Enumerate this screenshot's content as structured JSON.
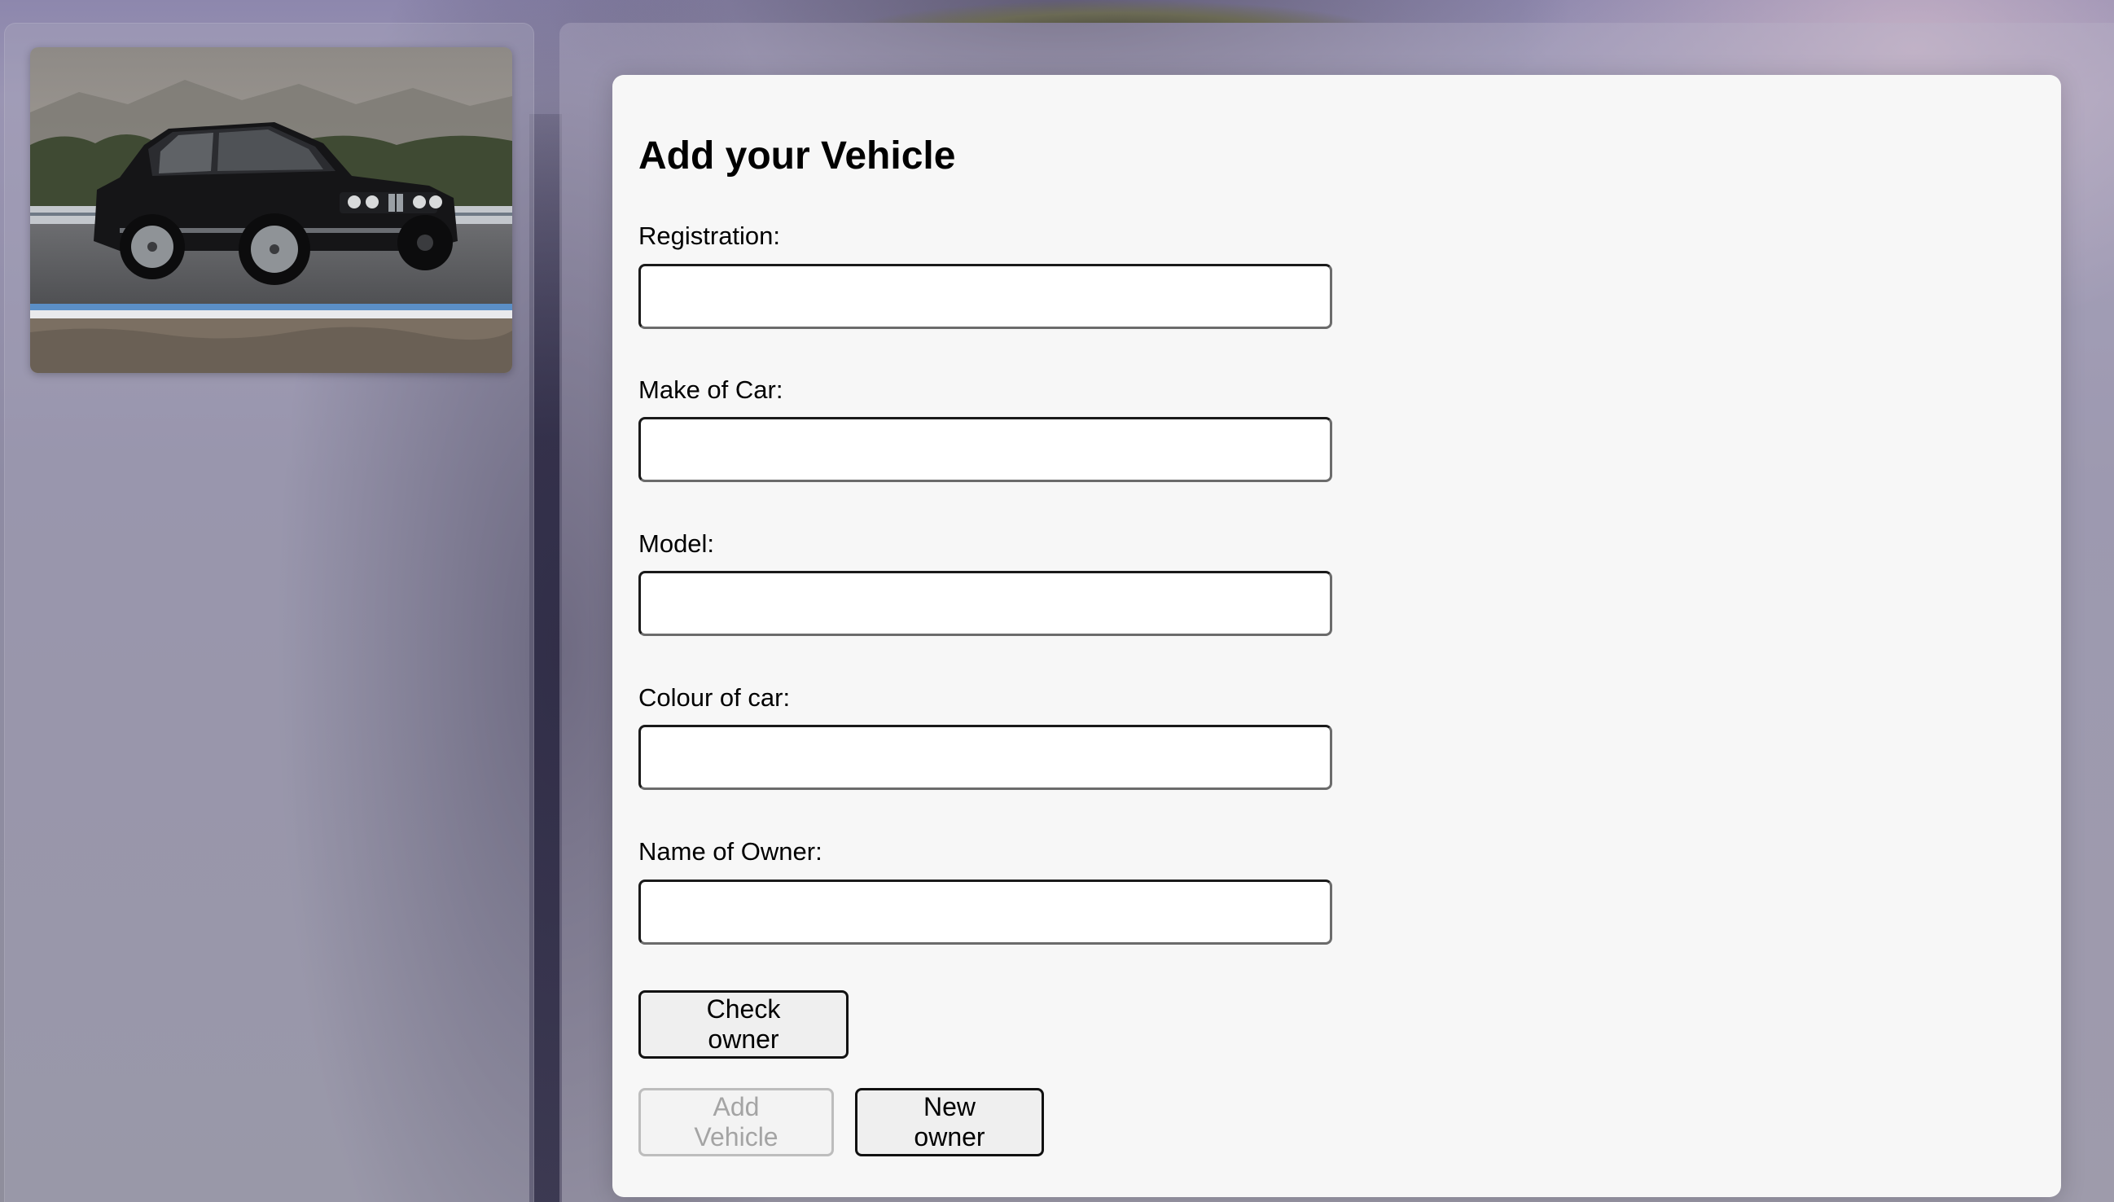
{
  "form": {
    "title": "Add your Vehicle",
    "fields": [
      {
        "label": "Registration:",
        "value": "",
        "placeholder": ""
      },
      {
        "label": "Make of Car:",
        "value": "",
        "placeholder": ""
      },
      {
        "label": "Model:",
        "value": "",
        "placeholder": ""
      },
      {
        "label": "Colour of car:",
        "value": "",
        "placeholder": ""
      },
      {
        "label": "Name of Owner:",
        "value": "",
        "placeholder": ""
      }
    ],
    "buttons": {
      "check_owner": "Check owner",
      "add_vehicle": "Add Vehicle",
      "new_owner": "New owner"
    }
  },
  "sidebar": {
    "image_subject": "black-sedan-car-photo"
  },
  "colors": {
    "card_background": "#f7f7f7",
    "button_background": "#efefef",
    "disabled_text": "#a4a4a4"
  }
}
